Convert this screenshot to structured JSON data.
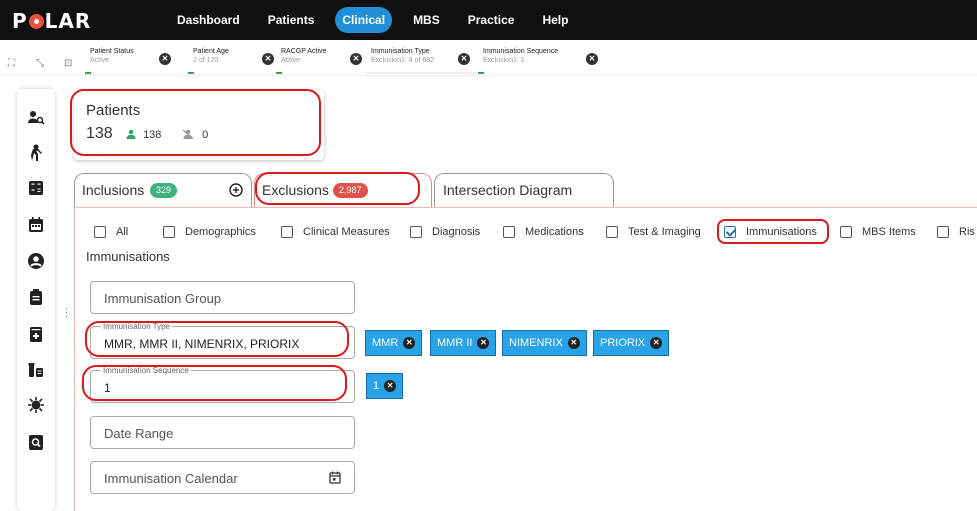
{
  "app": {
    "logo": "POLAR"
  },
  "nav": [
    {
      "label": "Dashboard",
      "active": false
    },
    {
      "label": "Patients",
      "active": false
    },
    {
      "label": "Clinical",
      "active": true
    },
    {
      "label": "MBS",
      "active": false
    },
    {
      "label": "Practice",
      "active": false
    },
    {
      "label": "Help",
      "active": false
    }
  ],
  "filters": [
    {
      "title": "Patient Status",
      "sub": "Active",
      "color": "#2aa84a"
    },
    {
      "title": "Patient Age",
      "sub": "2 of 120",
      "color": "#2aa84a"
    },
    {
      "title": "RACGP Active",
      "sub": "Active",
      "color": "#2aa84a"
    },
    {
      "title": "Immunisation Type",
      "sub": "Exclusion1: 4 of 682",
      "color": "#e0524b"
    },
    {
      "title": "Immunisation Sequence",
      "sub": "Exclusion1: 1",
      "color": "#e0524b"
    }
  ],
  "patients": {
    "title": "Patients",
    "count": "138",
    "active": "138",
    "inactive": "0"
  },
  "tabs": {
    "inclusions": {
      "label": "Inclusions",
      "badge": "329",
      "badge_color": "#3fb27f"
    },
    "exclusions": {
      "label": "Exclusions",
      "badge": "2,987",
      "badge_color": "#e0524b"
    },
    "intersection": {
      "label": "Intersection Diagram"
    }
  },
  "categories": [
    {
      "label": "All",
      "checked": false
    },
    {
      "label": "Demographics",
      "checked": false
    },
    {
      "label": "Clinical Measures",
      "checked": false
    },
    {
      "label": "Diagnosis",
      "checked": false
    },
    {
      "label": "Medications",
      "checked": false
    },
    {
      "label": "Test & Imaging",
      "checked": false
    },
    {
      "label": "Immunisations",
      "checked": true
    },
    {
      "label": "MBS Items",
      "checked": false
    },
    {
      "label": "Ris",
      "checked": false
    }
  ],
  "section": {
    "title": "Immunisations"
  },
  "fields": {
    "group": {
      "placeholder": "Immunisation Group"
    },
    "type": {
      "legend": "Immunisation Type",
      "value": "MMR, MMR II, NIMENRIX, PRIORIX"
    },
    "sequence": {
      "legend": "Immunisation Sequence",
      "value": "1"
    },
    "date": {
      "placeholder": "Date Range"
    },
    "calendar": {
      "placeholder": "Immunisation Calendar"
    }
  },
  "type_tags": [
    "MMR",
    "MMR II",
    "NIMENRIX",
    "PRIORIX"
  ],
  "sequence_tags": [
    "1"
  ],
  "colors": {
    "accent": "#1f8fd8",
    "tag": "#29a3e8",
    "highlight": "#d8191e"
  }
}
